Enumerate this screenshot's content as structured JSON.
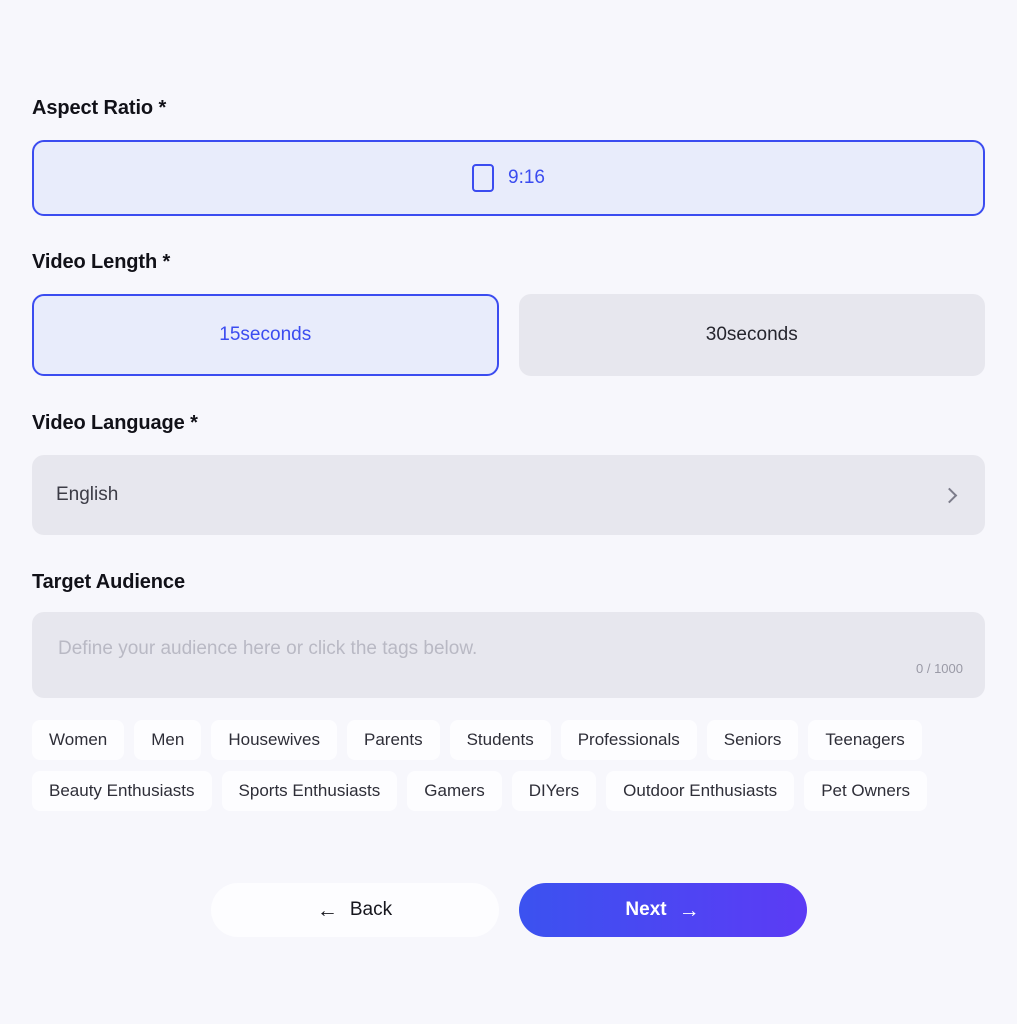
{
  "form": {
    "aspect_ratio": {
      "label": "Aspect Ratio *",
      "options": [
        {
          "value": "9:16",
          "icon": "portrait-rectangle-icon",
          "selected": true
        }
      ]
    },
    "video_length": {
      "label": "Video Length *",
      "options": [
        {
          "value": "15seconds",
          "selected": true
        },
        {
          "value": "30seconds",
          "selected": false
        }
      ]
    },
    "video_language": {
      "label": "Video Language *",
      "selected": "English",
      "chevron": "chevron-right-icon"
    },
    "target_audience": {
      "label": "Target Audience",
      "placeholder": "Define your audience here or click the tags below.",
      "value": "",
      "counter": "0 / 1000",
      "max_length": 1000,
      "tag_rows": [
        [
          "Women",
          "Men",
          "Housewives",
          "Parents",
          "Students",
          "Professionals",
          "Seniors",
          "Teenagers"
        ],
        [
          "Beauty Enthusiasts",
          "Sports Enthusiasts",
          "Gamers",
          "DIYers",
          "Outdoor Enthusiasts",
          "Pet Owners"
        ]
      ]
    }
  },
  "footer": {
    "back_label": "Back",
    "back_arrow": "←",
    "next_label": "Next",
    "next_arrow": "→"
  },
  "colors": {
    "page_background": "#f7f7fc",
    "accent": "#3b4cf0",
    "accent_fill": "#e8ecfb",
    "neutral_fill": "#e7e7ee",
    "next_gradient_start": "#3b52f0",
    "next_gradient_end": "#5c3bf5"
  }
}
